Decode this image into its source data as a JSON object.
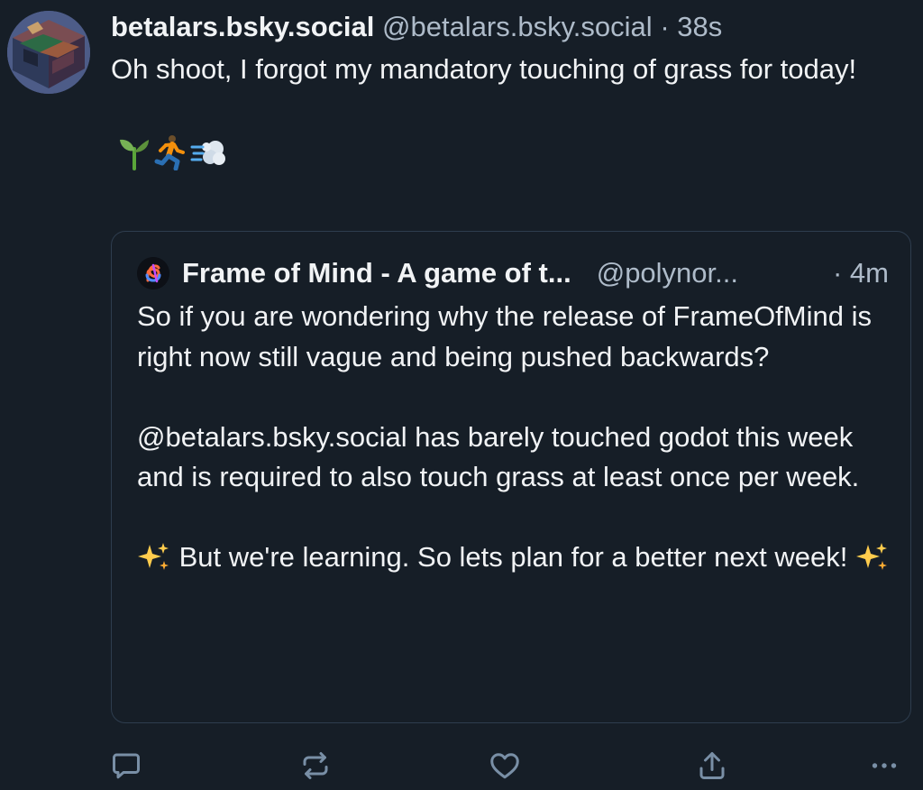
{
  "post": {
    "author_name": "betalars.bsky.social",
    "author_handle": "@betalars.bsky.social",
    "separator": "·",
    "timestamp": "38s",
    "text": "Oh shoot, I forgot my mandatory touching of grass for today!",
    "emoji": [
      "seedling-icon",
      "person-running-icon",
      "dashing-away-icon"
    ]
  },
  "quote": {
    "author_name": "Frame of Mind - A game of t...",
    "author_handle": "@polynor...",
    "timestamp": "· 4m",
    "paragraphs": [
      "So if you are wondering why the release of FrameOfMind is right now still vague and being pushed backwards?",
      "@betalars.bsky.social has barely touched godot this week and is required to also touch grass at least once per week.",
      "But we're learning. So lets plan for a better next week!"
    ]
  },
  "actions": [
    "reply-icon",
    "repost-icon",
    "like-icon",
    "share-icon",
    "more-icon"
  ],
  "colors": {
    "background": "#161e27",
    "text_primary": "#f1f3f5",
    "text_secondary": "#aebbc9",
    "border": "#2e3d4e",
    "icon": "#798fa6"
  }
}
